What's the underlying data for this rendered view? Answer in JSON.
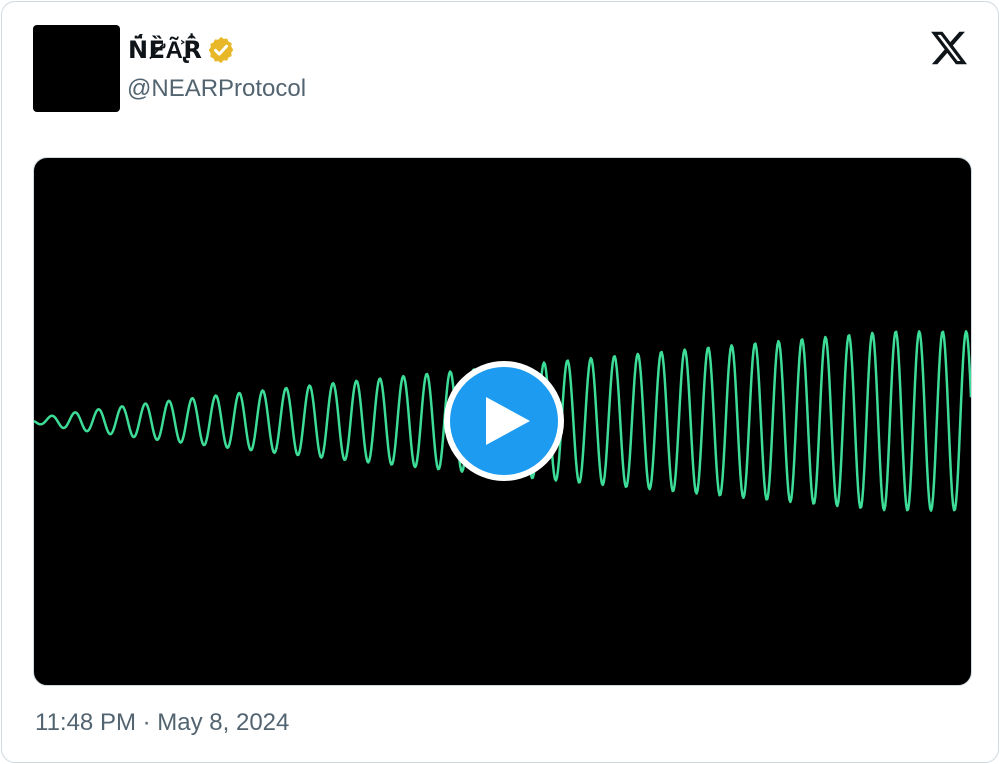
{
  "tweet": {
    "display_name": "N̈́Ȅ̷̛Ã̢͐R̂̍",
    "handle": "@NEARProtocol",
    "verified_icon": "verified-badge-gold",
    "time": "11:48 PM",
    "separator": "·",
    "date": "May 8, 2024"
  },
  "platform": {
    "logo_icon": "x-logo"
  },
  "media": {
    "type": "video",
    "play_icon": "play-icon",
    "wave_color": "#3ddc97",
    "background": "#000000"
  },
  "colors": {
    "accent": "#1d9bf0",
    "verified_gold": "#e8b829",
    "text_primary": "#0f1419",
    "text_secondary": "#536471",
    "border": "#cfd9de"
  }
}
